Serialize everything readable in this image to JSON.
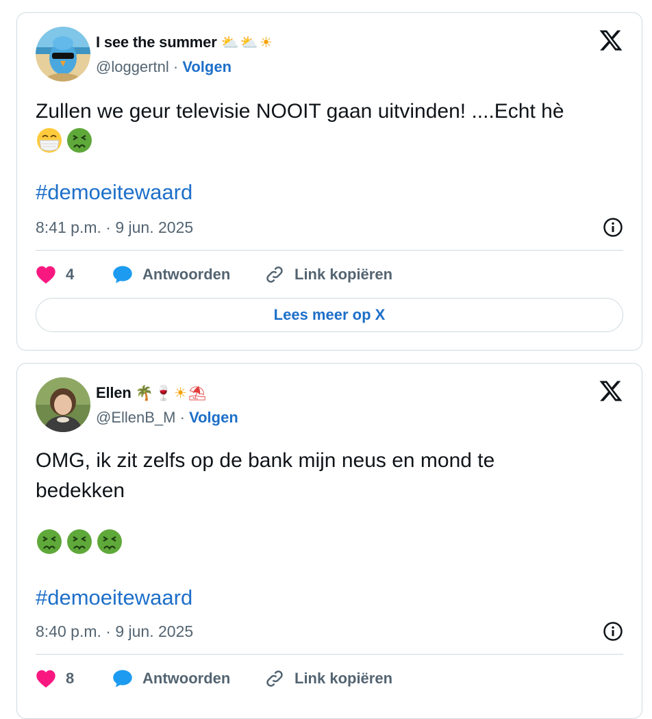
{
  "tweets": [
    {
      "display_name": "I see the summer",
      "name_emoji": "⛅⛅☀",
      "handle": "@loggertnl",
      "separator": "·",
      "follow_label": "Volgen",
      "text": "Zullen we geur televisie NOOIT gaan uitvinden! ....Echt hè",
      "emojis": [
        "mask-face",
        "nauseated-face"
      ],
      "hashtag": "#demoeitewaard",
      "timestamp": "8:41 p.m. · 9 jun. 2025",
      "likes": "4",
      "reply_label": "Antwoorden",
      "copy_link_label": "Link kopiëren",
      "read_more_label": "Lees meer op X"
    },
    {
      "display_name": "Ellen",
      "name_emoji": "🌴🍷☀⛱",
      "handle": "@EllenB_M",
      "separator": "·",
      "follow_label": "Volgen",
      "text_line1": "OMG, ik zit zelfs op de bank mijn neus en mond te",
      "text_line2": "bedekken",
      "emojis": [
        "nauseated-face",
        "nauseated-face",
        "nauseated-face"
      ],
      "hashtag": "#demoeitewaard",
      "timestamp": "8:40 p.m. · 9 jun. 2025",
      "likes": "8",
      "reply_label": "Antwoorden",
      "copy_link_label": "Link kopiëren"
    }
  ],
  "colors": {
    "link_blue": "#1d6fc9",
    "like_pink": "#f91880",
    "reply_blue": "#1d9bf0",
    "muted_text": "#536471",
    "border": "#cfd9de"
  },
  "icons": [
    "x-logo-icon",
    "info-icon",
    "heart-icon",
    "reply-bubble-icon",
    "link-icon"
  ]
}
